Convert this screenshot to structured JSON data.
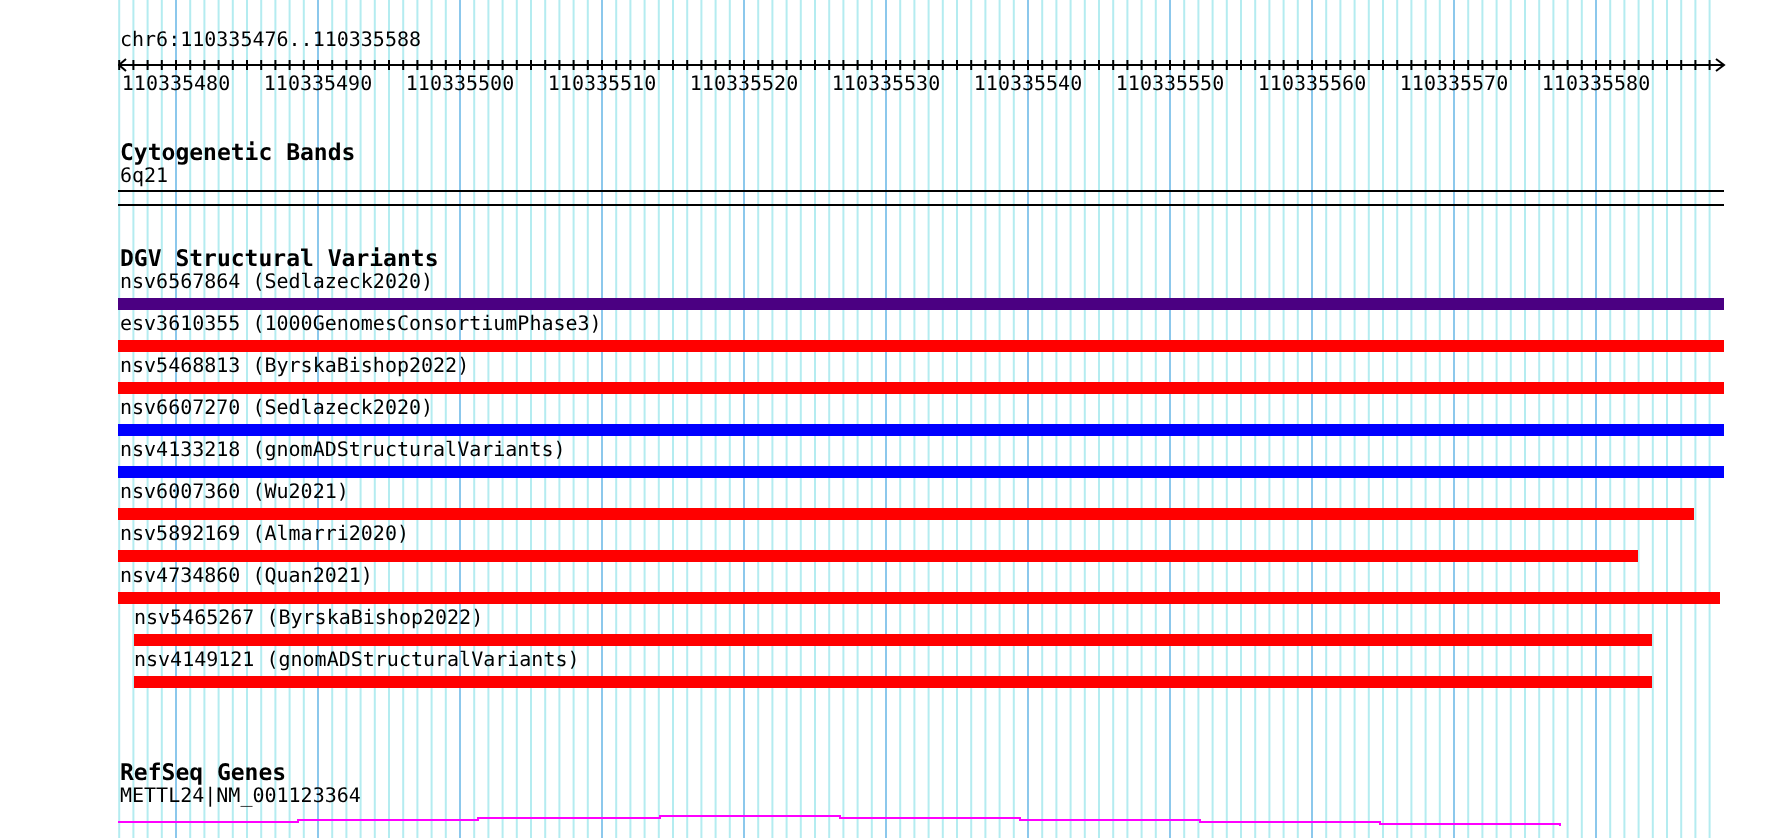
{
  "location": "chr6:110335476..110335588",
  "ruler": {
    "ticks": [
      "110335480",
      "110335490",
      "110335500",
      "110335510",
      "110335520",
      "110335530",
      "110335540",
      "110335550",
      "110335560",
      "110335570",
      "110335580"
    ]
  },
  "cytogenetic_bands": {
    "title": "Cytogenetic Bands",
    "band": "6q21"
  },
  "dgv_structural_variants": {
    "title": "DGV Structural Variants",
    "features": [
      {
        "label": "nsv6567864 (Sedlazeck2020)",
        "color": "#4b0082",
        "kind": "flush",
        "level": 1
      },
      {
        "label": "esv3610355 (1000GenomesConsortiumPhase3)",
        "color": "#ff0000",
        "kind": "flush",
        "level": 1
      },
      {
        "label": "nsv5468813 (ByrskaBishop2022)",
        "color": "#ff0000",
        "kind": "flush",
        "level": 1
      },
      {
        "label": "nsv6607270 (Sedlazeck2020)",
        "color": "#0000ff",
        "kind": "flush",
        "level": 1
      },
      {
        "label": "nsv4133218 (gnomADStructuralVariants)",
        "color": "#0000ff",
        "kind": "flush",
        "level": 1
      },
      {
        "label": "nsv6007360 (Wu2021)",
        "color": "#ff0000",
        "kind": "flush",
        "level": 0.981
      },
      {
        "label": "nsv5892169 (Almarri2020)",
        "color": "#ff0000",
        "kind": "flush",
        "level": 0.946
      },
      {
        "label": "nsv4734860 (Quan2021)",
        "color": "#ff0000",
        "kind": "flush",
        "level": 0.997
      },
      {
        "label": "nsv5465267 (ByrskaBishop2022)",
        "color": "#ff0000",
        "kind": "inset",
        "level": 0.955
      },
      {
        "label": "nsv4149121 (gnomADStructuralVariants)",
        "color": "#ff0000",
        "kind": "inset",
        "level": 0.955
      }
    ]
  },
  "refseq_genes": {
    "title": "RefSeq Genes",
    "gene": "METTL24|NM_001123364"
  }
}
